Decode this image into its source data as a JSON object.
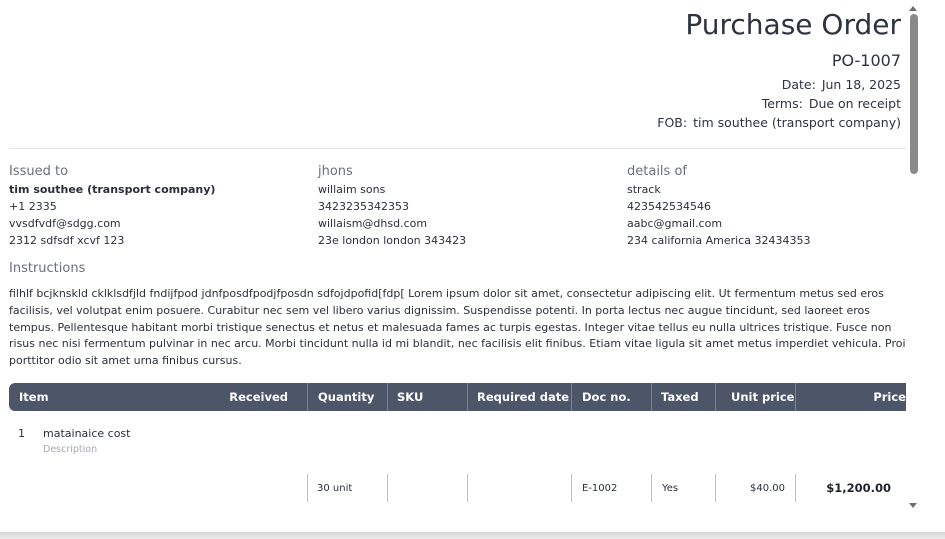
{
  "header": {
    "title": "Purchase Order",
    "po_number": "PO-1007",
    "meta": [
      {
        "label": "Date:",
        "value": "Jun 18, 2025"
      },
      {
        "label": "Terms:",
        "value": "Due on receipt"
      },
      {
        "label": "FOB:",
        "value": "tim southee (transport company)"
      }
    ]
  },
  "parties": [
    {
      "heading": "Issued to",
      "lines": [
        "tim southee (transport company)",
        "+1 2335",
        "vvsdfvdf@sdgg.com",
        "2312 sdfsdf xcvf 123"
      ]
    },
    {
      "heading": "jhons",
      "lines": [
        "willaim sons",
        "3423235342353",
        "willaism@dhsd.com",
        "23e london london 343423"
      ]
    },
    {
      "heading": "details of",
      "lines": [
        "strack",
        "423542534546",
        "aabc@gmail.com",
        "234 california America 32434353"
      ]
    }
  ],
  "instructions": {
    "heading": "Instructions",
    "text": "filhlf bcjknskld cklklsdfjld fndijfpod jdnfposdfpodjfposdn sdfojdpofid[fdp[ Lorem ipsum dolor sit amet, consectetur adipiscing elit. Ut fermentum metus sed eros facilisis, vel volutpat enim posuere. Curabitur nec sem vel libero varius dignissim. Suspendisse potenti. In porta lectus nec augue tincidunt, sed laoreet eros tempus. Pellentesque habitant morbi tristique senectus et netus et malesuada fames ac turpis egestas. Integer vitae tellus eu nulla ultrices tristique. Fusce non risus nec nisi fermentum pulvinar in nec arcu. Morbi tincidunt nulla id mi blandit, nec facilisis elit finibus. Etiam vitae ligula sit amet metus imperdiet vehicula. Proin porttitor odio sit amet urna finibus cursus."
  },
  "table": {
    "columns": [
      "Item",
      "Received",
      "Quantity",
      "SKU",
      "Required date",
      "Doc no.",
      "Taxed",
      "Unit price",
      "Price"
    ],
    "rows": [
      {
        "num": "1",
        "name": "matainaice cost",
        "description": "Description",
        "quantity": "30 unit",
        "sku": "",
        "required_date": "",
        "doc_no": "E-1002",
        "taxed": "Yes",
        "unit_price": "$40.00",
        "price": "$1,200.00"
      }
    ]
  },
  "colors": {
    "table_header_bg": "#4d5668",
    "text": "#2a2f3a",
    "muted": "#6b7079"
  }
}
